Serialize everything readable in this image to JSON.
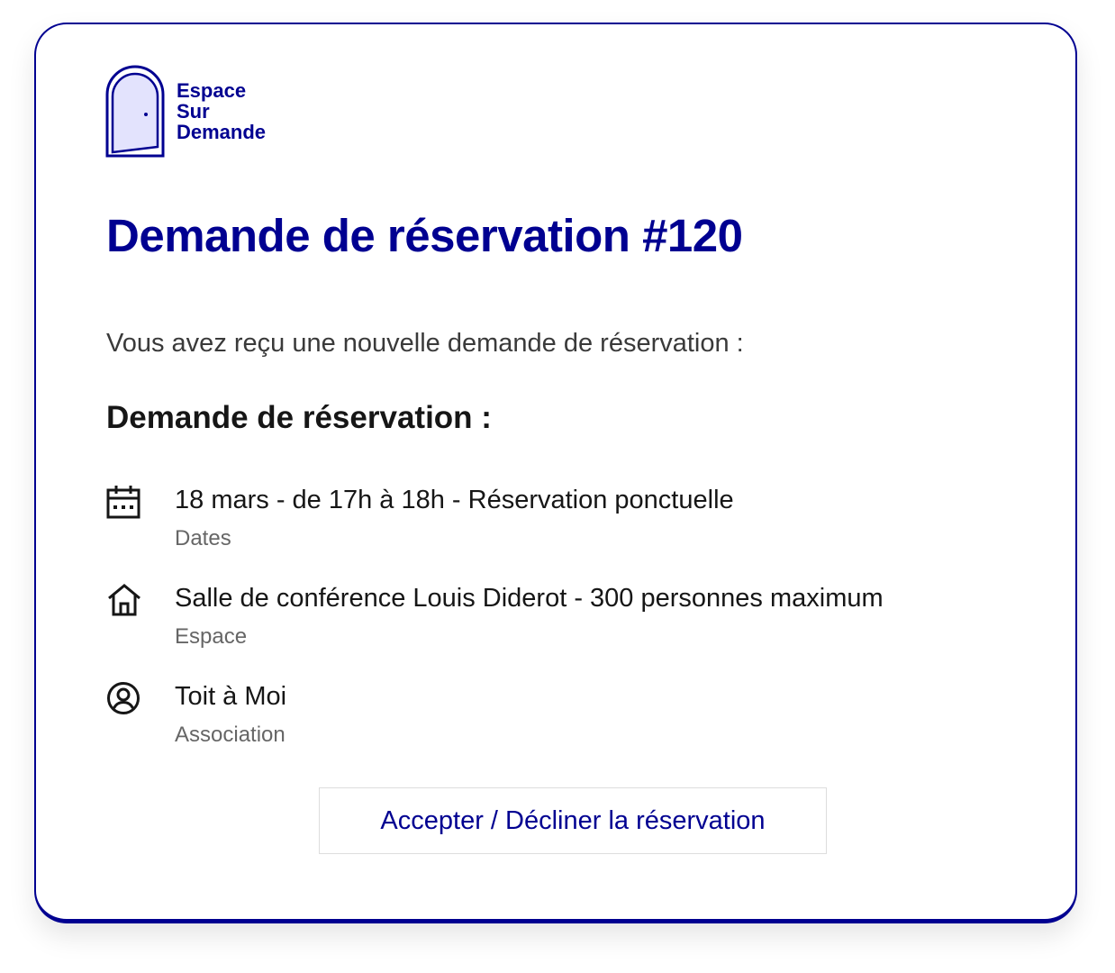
{
  "brand": {
    "logo_lines": [
      "Espace",
      "Sur",
      "Demande"
    ],
    "color": "#000091",
    "logo_icon": "door-icon"
  },
  "title": "Demande de réservation #120",
  "intro": "Vous avez reçu une nouvelle demande de réservation :",
  "section_title": "Demande de réservation :",
  "details": [
    {
      "icon": "calendar-icon",
      "value": "18 mars - de 17h à 18h - Réservation ponctuelle",
      "label": "Dates"
    },
    {
      "icon": "home-icon",
      "value": "Salle de conférence Louis Diderot - 300 personnes maximum",
      "label": "Espace"
    },
    {
      "icon": "user-circle-icon",
      "value": "Toit à Moi",
      "label": "Association"
    }
  ],
  "action": {
    "label": "Accepter / Décliner la réservation"
  }
}
